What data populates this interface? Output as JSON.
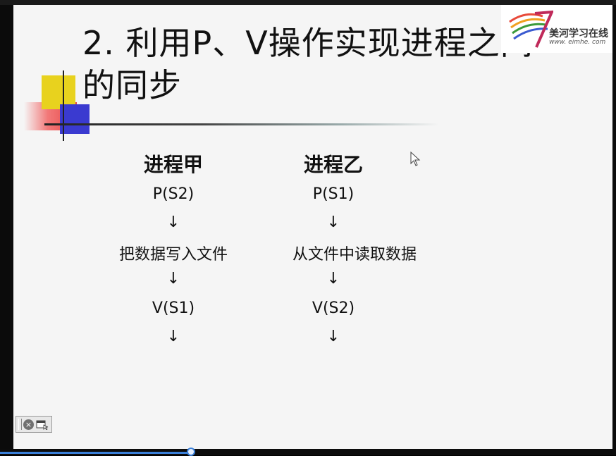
{
  "slide": {
    "title_line1": "2. 利用P、V操作实现进程之间",
    "title_line2": "的同步"
  },
  "logo": {
    "name": "美河学习在线",
    "url": "www. eimhe. com"
  },
  "process_a": {
    "heading": "进程甲",
    "steps": [
      "P(S2)",
      "把数据写入文件",
      "V(S1)"
    ]
  },
  "process_b": {
    "heading": "进程乙",
    "steps": [
      "P(S1)",
      "从文件中读取数据",
      "V(S2)"
    ]
  },
  "arrow_glyph": "↓",
  "player": {
    "progress": 0.31
  },
  "colors": {
    "accent_yellow": "#e8d21e",
    "accent_blue": "#3a3ad0",
    "accent_red": "#e83030",
    "progress_blue": "#3a7fd8"
  },
  "icons": [
    "close-icon",
    "window-icon",
    "pointer-cursor-icon",
    "logo-swoosh-icon"
  ]
}
